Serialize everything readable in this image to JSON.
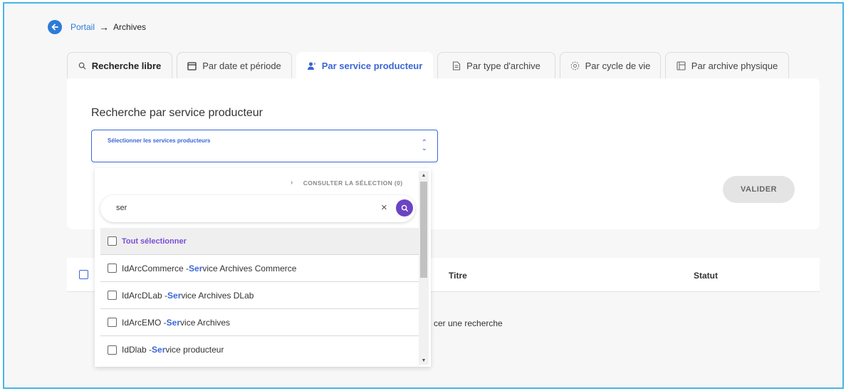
{
  "breadcrumb": {
    "back_icon": "arrow-left-circle-icon",
    "portal": "Portail",
    "separator": "→",
    "current": "Archives"
  },
  "tabs": [
    {
      "label": "Recherche libre",
      "icon": "search-icon"
    },
    {
      "label": "Par date et période",
      "icon": "calendar-icon"
    },
    {
      "label": "Par service producteur",
      "icon": "user-icon"
    },
    {
      "label": "Par type d'archive",
      "icon": "document-icon"
    },
    {
      "label": "Par cycle de vie",
      "icon": "cycle-icon"
    },
    {
      "label": "Par archive physique",
      "icon": "box-icon"
    }
  ],
  "active_tab": "Par service producteur",
  "form": {
    "title": "Recherche par service producteur",
    "select_label": "Sélectionner les services producteurs",
    "validate_label": "VALIDER"
  },
  "dropdown": {
    "consult_label": "CONSULTER LA SÉLECTION (0)",
    "search_value": "ser",
    "clear_symbol": "×",
    "select_all": "Tout sélectionner",
    "options": [
      {
        "prefix": "IdArcCommerce - ",
        "match": "Ser",
        "rest": "vice Archives Commerce"
      },
      {
        "prefix": "IdArcDLab - ",
        "match": "Ser",
        "rest": "vice Archives DLab"
      },
      {
        "prefix": "IdArcEMO - ",
        "match": "Ser",
        "rest": "vice Archives"
      },
      {
        "prefix": "IdDlab - ",
        "match": "Ser",
        "rest": "vice producteur"
      }
    ]
  },
  "table": {
    "columns": [
      "Titre",
      "Statut"
    ],
    "empty_message": "cer une recherche"
  },
  "colors": {
    "accent": "#3b66d6",
    "search_button": "#6a44c4",
    "frame_border": "#46b6e6"
  }
}
